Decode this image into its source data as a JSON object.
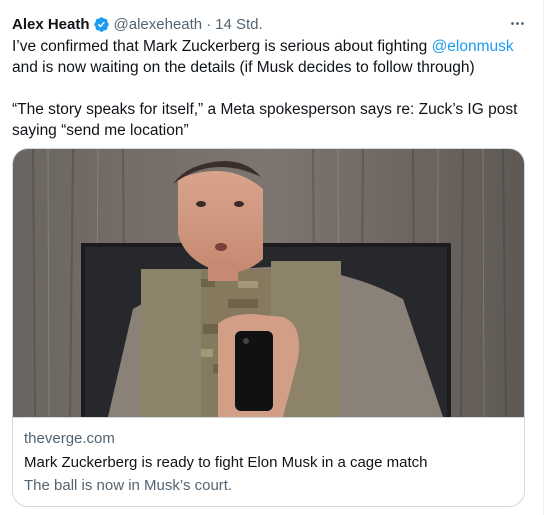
{
  "tweet": {
    "author_name": "Alex Heath",
    "handle": "@alexeheath",
    "separator": "·",
    "time": "14 Std.",
    "text_line1_before": "I’ve confirmed that Mark Zuckerberg is serious about fighting ",
    "mention": "@elonmusk",
    "text_line1_after": " and is now waiting on the details (if Musk decides to follow through)",
    "quote_text": "“The story speaks for itself,” a Meta spokesperson says re: Zuck’s IG post saying “send me location”",
    "icons": {
      "verified": "verified-badge-icon",
      "more": "more-horizontal-icon"
    },
    "colors": {
      "accent": "#1d9bf0",
      "secondary_text": "#536471",
      "border": "#cfd9de"
    }
  },
  "card": {
    "domain": "theverge.com",
    "title": "Mark Zuckerberg is ready to fight Elon Musk in a cage match",
    "description": "The ball is now in Musk’s court."
  }
}
